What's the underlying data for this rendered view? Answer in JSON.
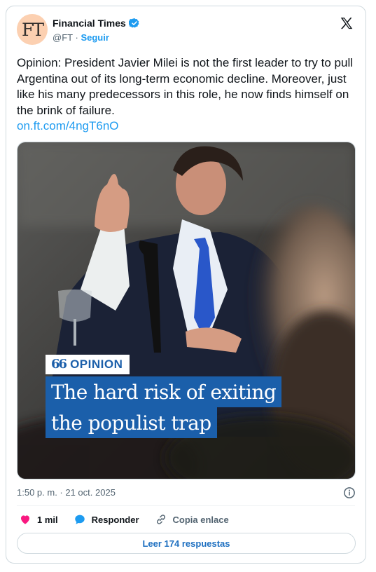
{
  "account": {
    "avatar_text": "FT",
    "name": "Financial Times",
    "handle": "@FT",
    "separator": "·",
    "follow_label": "Seguir"
  },
  "tweet": {
    "text": "Opinion: President Javier Milei is not the first leader to try to pull Argentina out of its long-term economic decline. Moreover, just like his many predecessors in this role, he now finds himself on the brink of failure.",
    "link": "on.ft.com/4ngT6nO"
  },
  "media": {
    "tag": "OPINION",
    "quote_mark": "66",
    "headline_line1": "The hard risk of exiting",
    "headline_line2": "the populist trap"
  },
  "meta": {
    "timestamp": "1:50 p. m. · 21 oct. 2025"
  },
  "actions": {
    "likes": "1 mil",
    "reply_label": "Responder",
    "copy_label": "Copia enlace"
  },
  "footer": {
    "read_replies_label": "Leer 174 respuestas"
  },
  "colors": {
    "accent": "#1d9bf0",
    "ft_pink": "#fcd0b1",
    "ft_blue": "#1b5faa",
    "heart": "#f91880"
  }
}
